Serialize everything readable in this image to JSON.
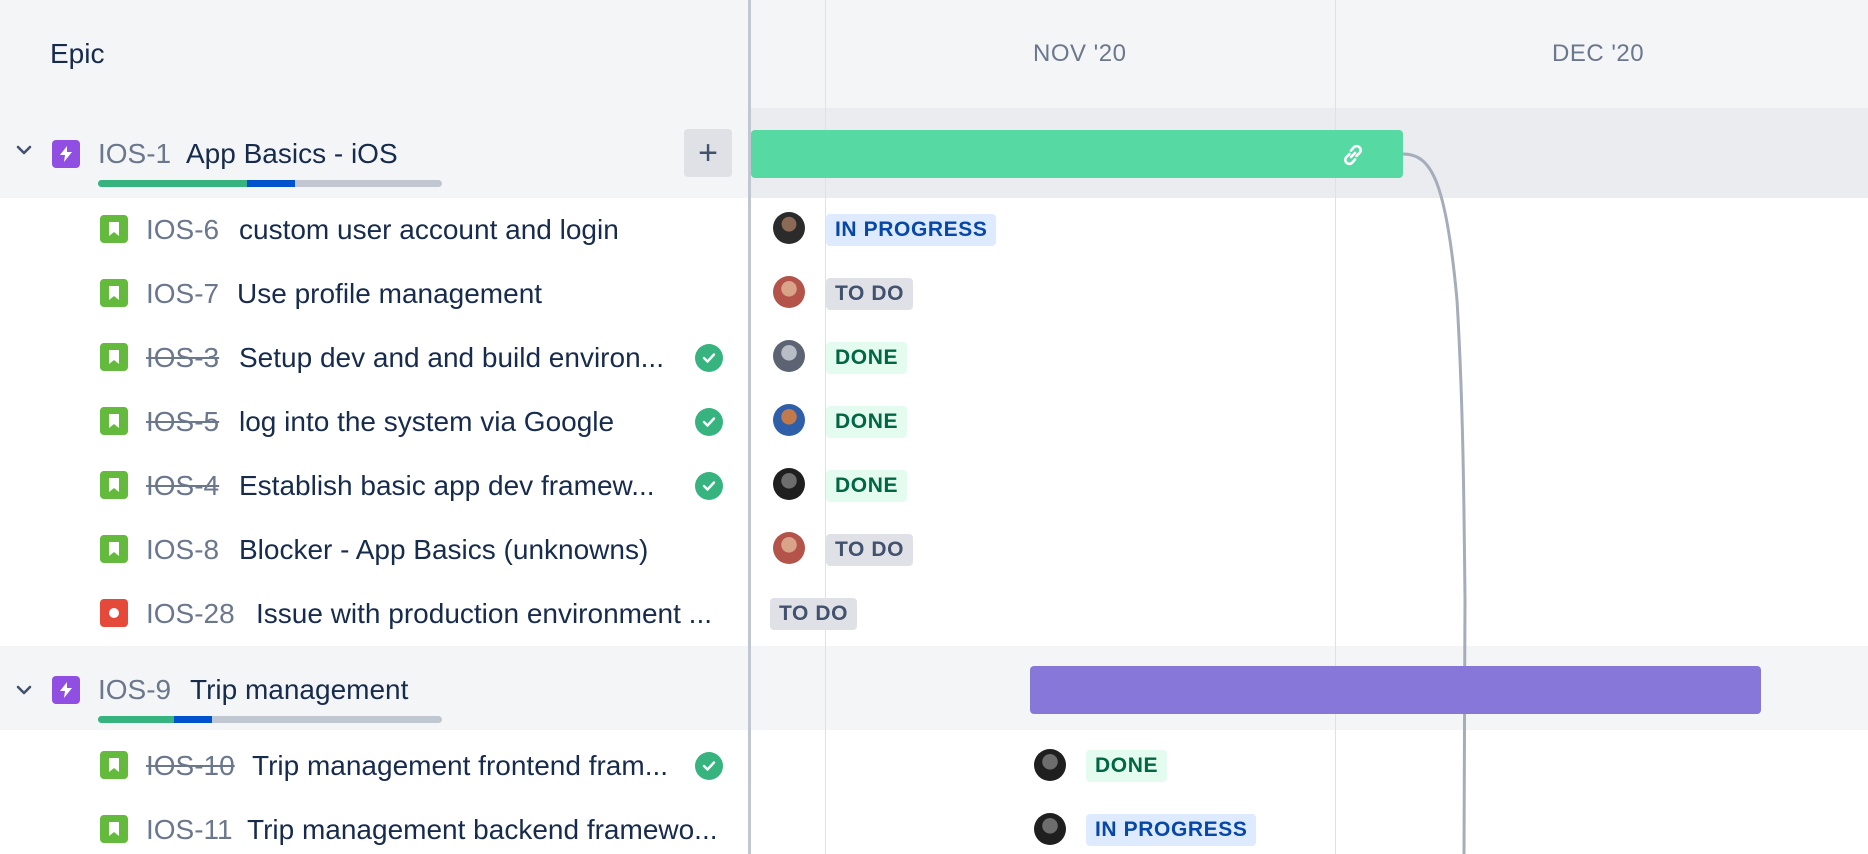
{
  "header": {
    "epic_label": "Epic",
    "months": [
      "NOV '20",
      "DEC '20"
    ]
  },
  "epics": [
    {
      "key": "IOS-1",
      "summary": "App Basics - iOS",
      "progress": {
        "done": 0.43,
        "in_progress": 0.14
      },
      "add_label": "+",
      "bar_color": "#57D9A3",
      "children": [
        {
          "key": "IOS-6",
          "summary": "custom user account and login",
          "type": "story",
          "resolved": false,
          "status": "IN PROGRESS"
        },
        {
          "key": "IOS-7",
          "summary": "Use profile management",
          "type": "story",
          "resolved": false,
          "status": "TO DO"
        },
        {
          "key": "IOS-3",
          "summary": "Setup dev and and build environ...",
          "type": "story",
          "resolved": true,
          "status": "DONE"
        },
        {
          "key": "IOS-5",
          "summary": "log into the system via Google",
          "type": "story",
          "resolved": true,
          "status": "DONE"
        },
        {
          "key": "IOS-4",
          "summary": "Establish basic app dev framew...",
          "type": "story",
          "resolved": true,
          "status": "DONE"
        },
        {
          "key": "IOS-8",
          "summary": "Blocker - App Basics (unknowns)",
          "type": "story",
          "resolved": false,
          "status": "TO DO"
        },
        {
          "key": "IOS-28",
          "summary": "Issue with production environment ...",
          "type": "bug",
          "resolved": false,
          "status": "TO DO"
        }
      ]
    },
    {
      "key": "IOS-9",
      "summary": "Trip management",
      "progress": {
        "done": 0.22,
        "in_progress": 0.11
      },
      "bar_color": "#8777D9",
      "children": [
        {
          "key": "IOS-10",
          "summary": "Trip management frontend fram...",
          "type": "story",
          "resolved": true,
          "status": "DONE"
        },
        {
          "key": "IOS-11",
          "summary": "Trip management backend framewo...",
          "type": "story",
          "resolved": false,
          "status": "IN PROGRESS"
        }
      ]
    }
  ],
  "colors": {
    "story": "#63BA3C",
    "bug": "#E5493A",
    "epic_icon": "#904EE2",
    "progress_done": "#36B37E",
    "progress_in_progress": "#0052CC"
  },
  "icons": {
    "expand": "chevron-down-icon",
    "epic": "lightning-icon",
    "story": "bookmark-icon",
    "bug": "bug-icon",
    "resolved": "check-circle-icon",
    "dependency": "link-icon"
  }
}
